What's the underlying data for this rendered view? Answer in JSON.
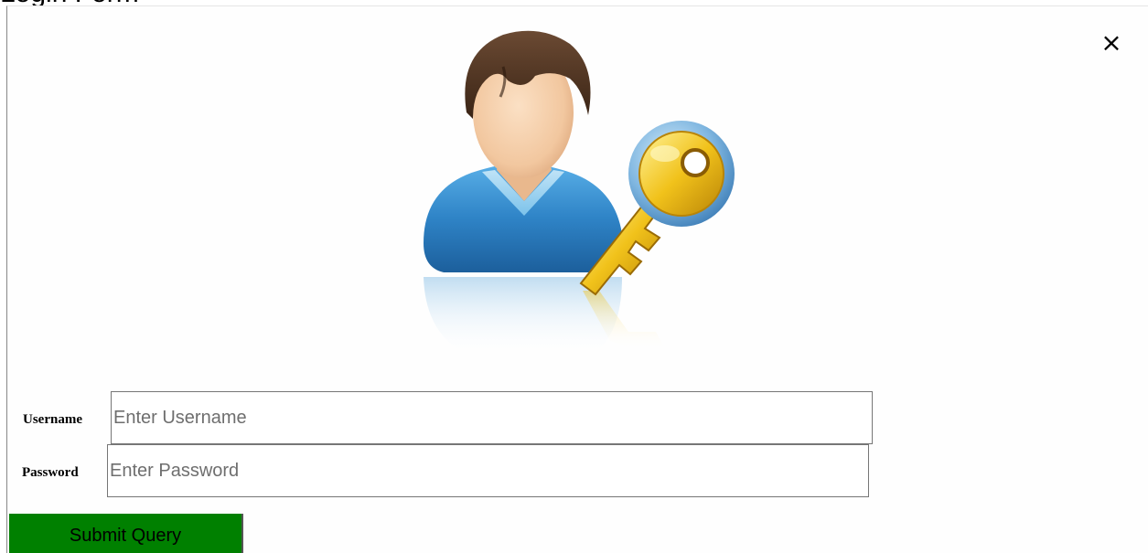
{
  "page": {
    "top_text": "Login Form"
  },
  "modal": {
    "close_glyph": "×"
  },
  "form": {
    "username_label": "Username",
    "username_placeholder": "Enter Username",
    "username_value": "",
    "password_label": "Password",
    "password_placeholder": "Enter Password",
    "password_value": "",
    "submit_label": "Submit Query",
    "submit_color": "#008000"
  },
  "icons": {
    "avatar": "user-with-key-icon",
    "close": "close-icon"
  }
}
